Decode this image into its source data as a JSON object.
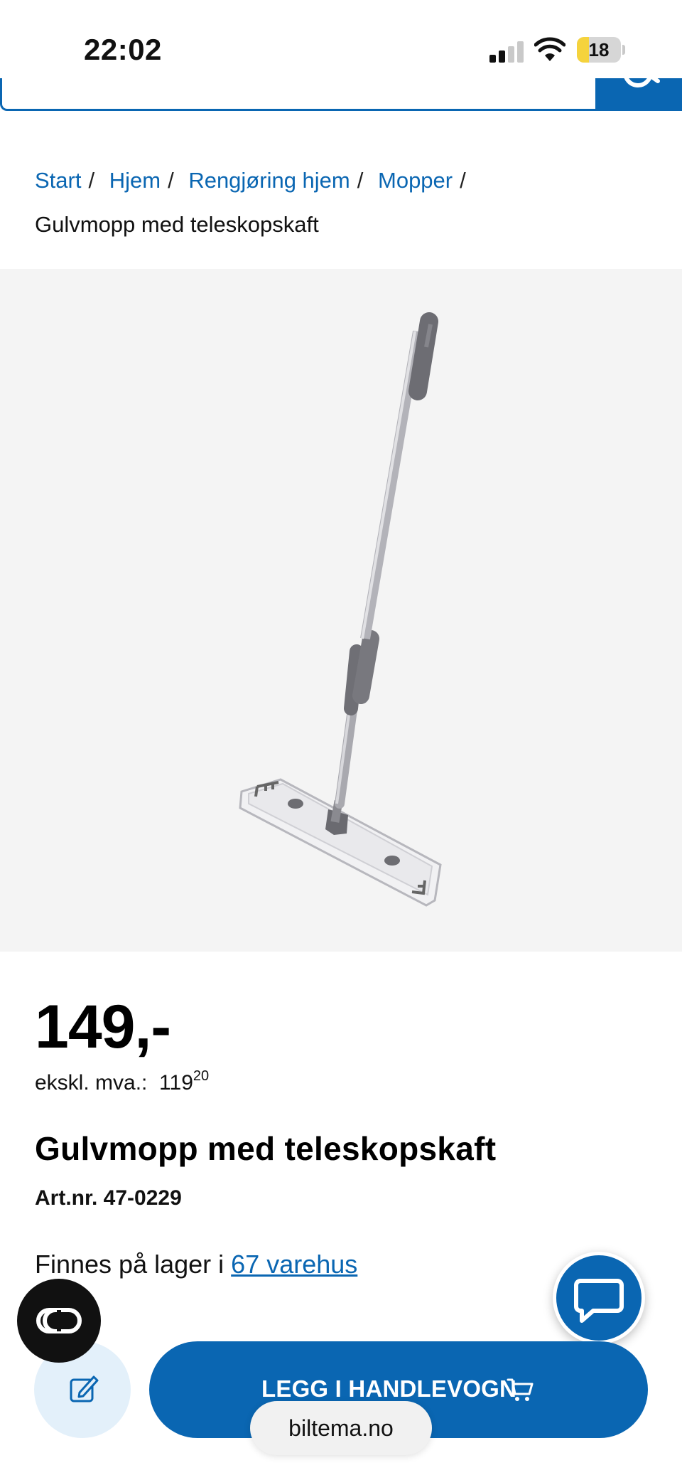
{
  "status_bar": {
    "time": "22:02",
    "battery_level": "18"
  },
  "search": {
    "placeholder": ""
  },
  "breadcrumb": {
    "items": [
      "Start",
      "Hjem",
      "Rengjøring hjem",
      "Mopper"
    ],
    "separator": "/",
    "current": "Gulvmopp med teleskopskaft"
  },
  "product": {
    "price": "149,-",
    "vat_label": "ekskl. mva.:",
    "vat_value": "119",
    "vat_cents": "20",
    "title": "Gulvmopp med teleskopskaft",
    "art_nr": "Art.nr. 47-0229",
    "stock_text": "Finnes på lager i",
    "stock_link": "67 varehus"
  },
  "actions": {
    "add_to_cart_label": "LEGG I HANDLEVOGN"
  },
  "browser": {
    "url": "biltema.no"
  },
  "colors": {
    "brand_blue": "#0a66b2",
    "image_bg": "#f4f4f4",
    "edit_button_bg": "#e3f0fa"
  },
  "icons": [
    "signal-icon",
    "wifi-icon",
    "battery-icon",
    "search-icon",
    "chat-icon",
    "co-icon",
    "edit-icon",
    "cart-icon"
  ]
}
